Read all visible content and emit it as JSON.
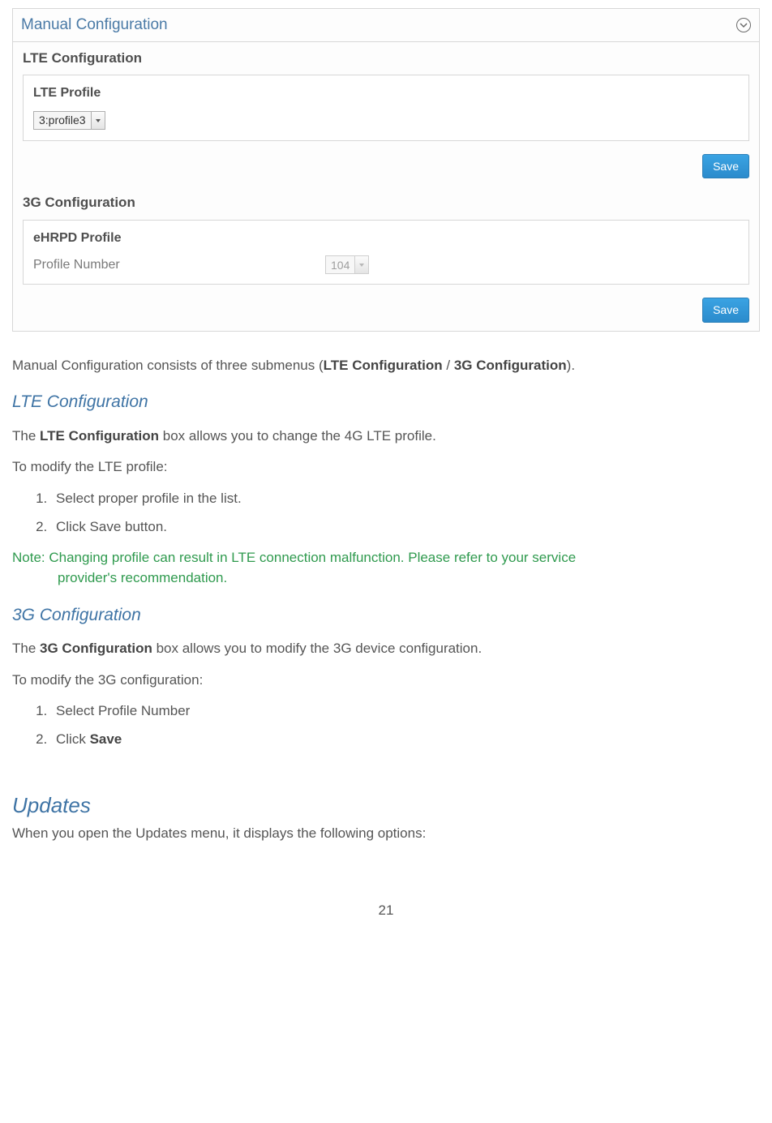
{
  "panel": {
    "title": "Manual Configuration",
    "lte_section": "LTE Configuration",
    "lte_profile_label": "LTE Profile",
    "lte_profile_value": "3:profile3",
    "save_label": "Save",
    "g3_section": "3G Configuration",
    "ehrpd_label": "eHRPD Profile",
    "profile_number_label": "Profile Number",
    "profile_number_value": "104"
  },
  "doc": {
    "p1_pre": "Manual Configuration consists of three submenus (",
    "p1_b1": "LTE Configuration",
    "p1_mid": " / ",
    "p1_b2": "3G Configuration",
    "p1_post": ").",
    "h_lte": "LTE Configuration",
    "p2_pre": "The ",
    "p2_b": "LTE Configuration",
    "p2_post": " box allows you to change the 4G LTE profile.",
    "p3": "To modify the LTE profile:",
    "lte_steps": {
      "s1": "Select proper profile in the list.",
      "s2": "Click Save button."
    },
    "note_line1": "Note: Changing profile can result in LTE connection malfunction. Please refer to your service",
    "note_line2": "provider's recommendation.",
    "h_3g": "3G Configuration",
    "p4_pre": "The ",
    "p4_b": "3G Configuration",
    "p4_post": " box allows you to modify the 3G device configuration.",
    "p5": "To modify the 3G configuration:",
    "g3_steps": {
      "s1": "Select Profile Number",
      "s2_pre": "Click ",
      "s2_b": "Save"
    },
    "h_updates": "Updates",
    "p6": "When you open the Updates menu, it displays the following options:",
    "page_number": "21"
  }
}
